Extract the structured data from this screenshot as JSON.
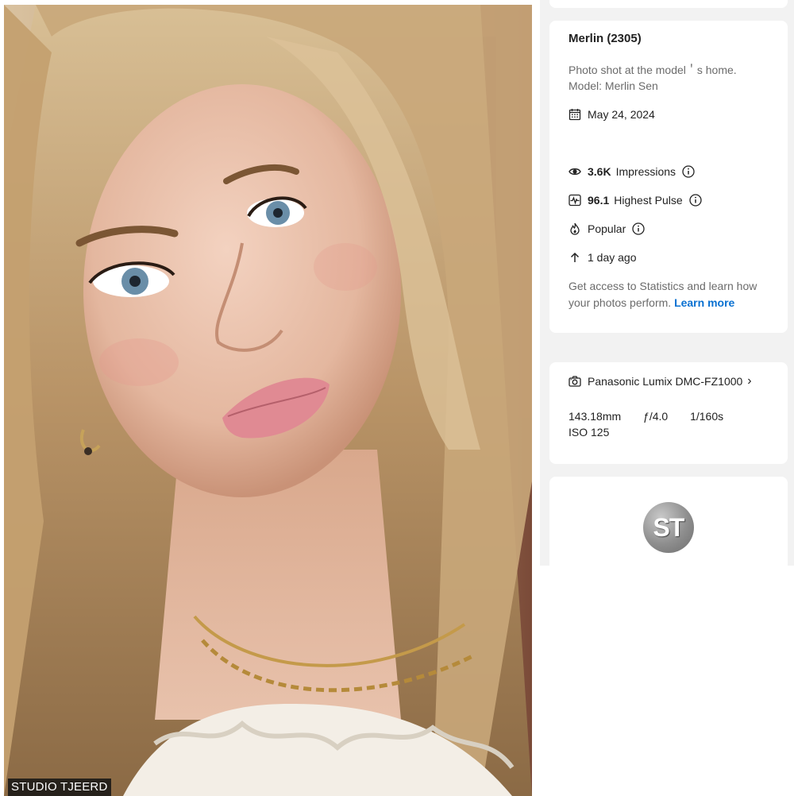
{
  "photo": {
    "watermark": "STUDIO TJEERD",
    "alt": "Portrait photo"
  },
  "info": {
    "title": "Merlin (2305)",
    "description_line1": "Photo shot at the model＇s home.",
    "description_line2": "Model: Merlin Sen",
    "date": "May 24, 2024",
    "impressions_value": "3.6K",
    "impressions_label": "Impressions",
    "pulse_value": "96.1",
    "pulse_label": "Highest Pulse",
    "popular_label": "Popular",
    "uploaded": "1 day ago",
    "promo_text": "Get access to Statistics and learn how your photos perform.",
    "promo_link": "Learn more"
  },
  "camera": {
    "model": "Panasonic Lumix DMC-FZ1000",
    "focal_length": "143.18mm",
    "aperture": "ƒ/4.0",
    "shutter": "1/160s",
    "iso": "ISO 125"
  },
  "profile": {
    "avatar_initials": "ST"
  },
  "icons": {
    "calendar": "calendar-icon",
    "eye": "eye-icon",
    "pulse": "pulse-icon",
    "flame": "flame-icon",
    "arrow_up": "arrow-up-icon",
    "info": "info-icon",
    "camera": "camera-icon",
    "chevron": "chevron-right-icon"
  },
  "colors": {
    "link": "#0870d1",
    "panel_bg": "#f2f2f2",
    "card_bg": "#ffffff",
    "text_primary": "#222222",
    "text_secondary": "#6b6b6b"
  }
}
